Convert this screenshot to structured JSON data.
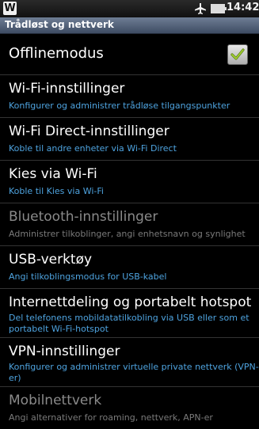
{
  "status": {
    "time": "14:42",
    "app_icon_letter": "W",
    "airplane_icon": "airplane-icon",
    "battery_icon": "battery-icon"
  },
  "titlebar": {
    "title": "Trådløst og nettverk"
  },
  "settings": [
    {
      "title": "Offlinemodus",
      "checked": true
    },
    {
      "title": "Wi-Fi-innstillinger",
      "subtitle": "Konfigurer og administrer trådløse tilgangspunkter"
    },
    {
      "title": "Wi-Fi Direct-innstillinger",
      "subtitle": "Koble til andre enheter via Wi-Fi Direct"
    },
    {
      "title": "Kies via Wi-Fi",
      "subtitle": "Koble til Kies via Wi-Fi"
    },
    {
      "title": "Bluetooth-innstillinger",
      "subtitle": "Administrer tilkoblinger, angi enhetsnavn og synlighet",
      "disabled": true
    },
    {
      "title": "USB-verktøy",
      "subtitle": "Angi tilkoblingsmodus for USB-kabel"
    },
    {
      "title": "Internettdeling og portabelt hotspot",
      "subtitle_line1": "Del telefonens mobildatatilkobling via USB eller som et",
      "subtitle_line2": "portabelt Wi-Fi-hotspot"
    },
    {
      "title": "VPN-innstillinger",
      "subtitle_line1": "Konfigurer og administrer virtuelle private nettverk (VPN-",
      "subtitle_line2": "er)"
    },
    {
      "title": "Mobilnettverk",
      "subtitle": "Angi alternativer for roaming, nettverk, APN-er",
      "disabled": true
    }
  ],
  "colors": {
    "accent": "#4ea3df",
    "title_bar": "#56657d",
    "background": "#000000"
  }
}
